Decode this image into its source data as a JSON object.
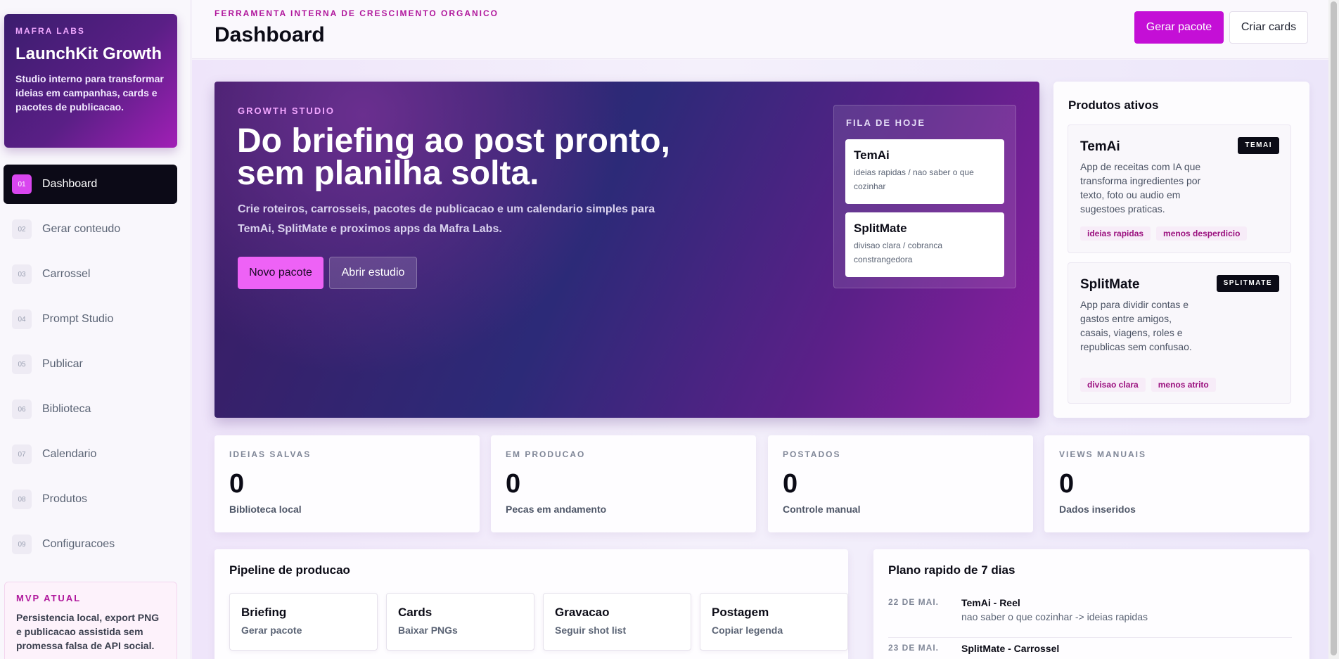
{
  "brand": {
    "kicker": "MAFRA LABS",
    "title": "LaunchKit Growth",
    "description": "Studio interno para transformar ideias em campanhas, cards e pacotes de publicacao."
  },
  "nav": [
    {
      "num": "01",
      "label": "Dashboard",
      "active": true
    },
    {
      "num": "02",
      "label": "Gerar conteudo"
    },
    {
      "num": "03",
      "label": "Carrossel"
    },
    {
      "num": "04",
      "label": "Prompt Studio"
    },
    {
      "num": "05",
      "label": "Publicar"
    },
    {
      "num": "06",
      "label": "Biblioteca"
    },
    {
      "num": "07",
      "label": "Calendario"
    },
    {
      "num": "08",
      "label": "Produtos"
    },
    {
      "num": "09",
      "label": "Configuracoes"
    }
  ],
  "mvp": {
    "kicker": "MVP ATUAL",
    "text": "Persistencia local, export PNG e publicacao assistida sem promessa falsa de API social."
  },
  "topbar": {
    "kicker": "FERRAMENTA INTERNA DE CRESCIMENTO ORGANICO",
    "title": "Dashboard",
    "primary_button": "Gerar pacote",
    "secondary_button": "Criar cards"
  },
  "hero": {
    "kicker": "GROWTH STUDIO",
    "title": "Do briefing ao post pronto, sem planilha solta.",
    "description": "Crie roteiros, carrosseis, pacotes de publicacao e um calendario simples para TemAi, SplitMate e proximos apps da Mafra Labs.",
    "primary_button": "Novo pacote",
    "secondary_button": "Abrir estudio",
    "queue": {
      "title": "FILA DE HOJE",
      "items": [
        {
          "name": "TemAi",
          "sub": "ideias rapidas / nao saber o que cozinhar"
        },
        {
          "name": "SplitMate",
          "sub": "divisao clara / cobranca constrangedora"
        }
      ]
    }
  },
  "products": {
    "title": "Produtos ativos",
    "items": [
      {
        "name": "TemAi",
        "badge": "TEMAI",
        "description": "App de receitas com IA que transforma ingredientes por texto, foto ou audio em sugestoes praticas.",
        "tags": [
          "ideias rapidas",
          "menos desperdicio"
        ]
      },
      {
        "name": "SplitMate",
        "badge": "SPLITMATE",
        "description": "App para dividir contas e gastos entre amigos, casais, viagens, roles e republicas sem confusao.",
        "tags": [
          "divisao clara",
          "menos atrito"
        ]
      }
    ]
  },
  "stats": [
    {
      "label": "IDEIAS SALVAS",
      "value": "0",
      "sub": "Biblioteca local"
    },
    {
      "label": "EM PRODUCAO",
      "value": "0",
      "sub": "Pecas em andamento"
    },
    {
      "label": "POSTADOS",
      "value": "0",
      "sub": "Controle manual"
    },
    {
      "label": "VIEWS MANUAIS",
      "value": "0",
      "sub": "Dados inseridos"
    }
  ],
  "pipeline": {
    "title": "Pipeline de producao",
    "stages": [
      {
        "name": "Briefing",
        "sub": "Gerar pacote"
      },
      {
        "name": "Cards",
        "sub": "Baixar PNGs"
      },
      {
        "name": "Gravacao",
        "sub": "Seguir shot list"
      },
      {
        "name": "Postagem",
        "sub": "Copiar legenda"
      }
    ]
  },
  "plan": {
    "title": "Plano rapido de 7 dias",
    "rows": [
      {
        "date": "22 DE MAI.",
        "name": "TemAi - Reel",
        "sub": "nao saber o que cozinhar -> ideias rapidas"
      },
      {
        "date": "23 DE MAI.",
        "name": "SplitMate - Carrossel",
        "sub": ""
      }
    ]
  },
  "colors": {
    "accent": "#c40fd6",
    "nav_active_bg": "#0c0a17",
    "hero_gradient_start": "#3d1b63",
    "hero_gradient_end": "#8d1ea1"
  }
}
